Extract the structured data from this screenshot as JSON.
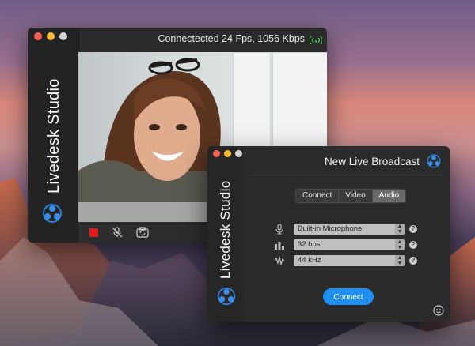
{
  "window_main": {
    "brand": "Livedesk Studio",
    "status": "Connectected 24 Fps, 1056 Kbps",
    "controls": [
      "record-stop",
      "mic-muted",
      "camera-switch"
    ]
  },
  "window_broadcast": {
    "brand": "Livedesk Studio",
    "title": "New Live Broadcast",
    "tabs": [
      {
        "label": "Connect",
        "active": false
      },
      {
        "label": "Video",
        "active": false
      },
      {
        "label": "Audio",
        "active": true
      }
    ],
    "fields": [
      {
        "icon": "microphone-icon",
        "value": "Built-in Microphone",
        "help": "?"
      },
      {
        "icon": "bitrate-icon",
        "value": "32 bps",
        "help": "?"
      },
      {
        "icon": "frequency-icon",
        "value": "44 kHz",
        "help": "?"
      }
    ],
    "connect_label": "Connect"
  },
  "colors": {
    "accent": "#1e8ef0",
    "record": "#e21b1b",
    "signal": "#3ec24a"
  }
}
